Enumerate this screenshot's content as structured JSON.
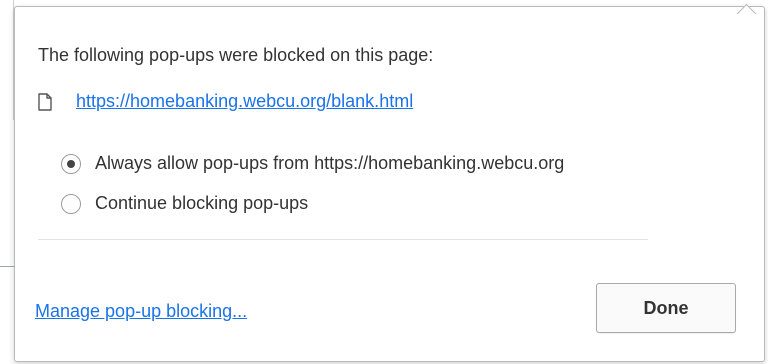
{
  "dialog": {
    "heading": "The following pop-ups were blocked on this page:",
    "blocked_popups": [
      {
        "url": "https://homebanking.webcu.org/blank.html",
        "icon": "page-icon"
      }
    ],
    "options": [
      {
        "label": "Always allow pop-ups from https://homebanking.webcu.org",
        "selected": true
      },
      {
        "label": "Continue blocking pop-ups",
        "selected": false
      }
    ],
    "manage_link": "Manage pop-up blocking...",
    "done_label": "Done"
  },
  "colors": {
    "link": "#1a73e8",
    "text": "#333333",
    "border": "#b9b9b9"
  }
}
